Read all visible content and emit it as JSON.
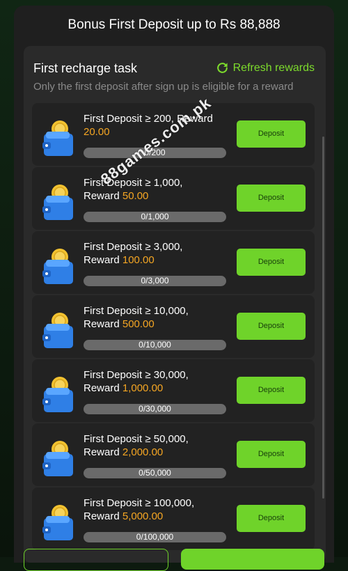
{
  "modal": {
    "title": "Bonus First Deposit up to Rs 88,888"
  },
  "panel": {
    "heading": "First recharge task",
    "refresh_label": "Refresh rewards",
    "subtitle": "Only the first deposit after sign up is eligible for a reward"
  },
  "tasks": [
    {
      "line1": "First Deposit ≥ 200, Reward",
      "line2_prefix": "",
      "reward": "20.00",
      "progress": "0/200",
      "progress_fraction": 0,
      "button": "Deposit"
    },
    {
      "line1": "First Deposit ≥ 1,000,",
      "line2_prefix": "Reward ",
      "reward": "50.00",
      "progress": "0/1,000",
      "progress_fraction": 0,
      "button": "Deposit"
    },
    {
      "line1": "First Deposit ≥ 3,000,",
      "line2_prefix": "Reward ",
      "reward": "100.00",
      "progress": "0/3,000",
      "progress_fraction": 0,
      "button": "Deposit"
    },
    {
      "line1": "First Deposit ≥ 10,000,",
      "line2_prefix": "Reward ",
      "reward": "500.00",
      "progress": "0/10,000",
      "progress_fraction": 0,
      "button": "Deposit"
    },
    {
      "line1": "First Deposit ≥ 30,000,",
      "line2_prefix": "Reward ",
      "reward": "1,000.00",
      "progress": "0/30,000",
      "progress_fraction": 0,
      "button": "Deposit"
    },
    {
      "line1": "First Deposit ≥ 50,000,",
      "line2_prefix": "Reward ",
      "reward": "2,000.00",
      "progress": "0/50,000",
      "progress_fraction": 0,
      "button": "Deposit"
    },
    {
      "line1": "First Deposit ≥ 100,000,",
      "line2_prefix": "Reward ",
      "reward": "5,000.00",
      "progress": "0/100,000",
      "progress_fraction": 0,
      "button": "Deposit"
    }
  ],
  "watermark": "88games.com.pk",
  "icons": {
    "task_icon": "wallet-coin-icon",
    "refresh_icon": "refresh-icon"
  },
  "colors": {
    "accent_green": "#6fd32a",
    "reward_orange": "#f5a623",
    "wallet_blue": "#3b8ff0",
    "coin_gold": "#f2c230"
  }
}
